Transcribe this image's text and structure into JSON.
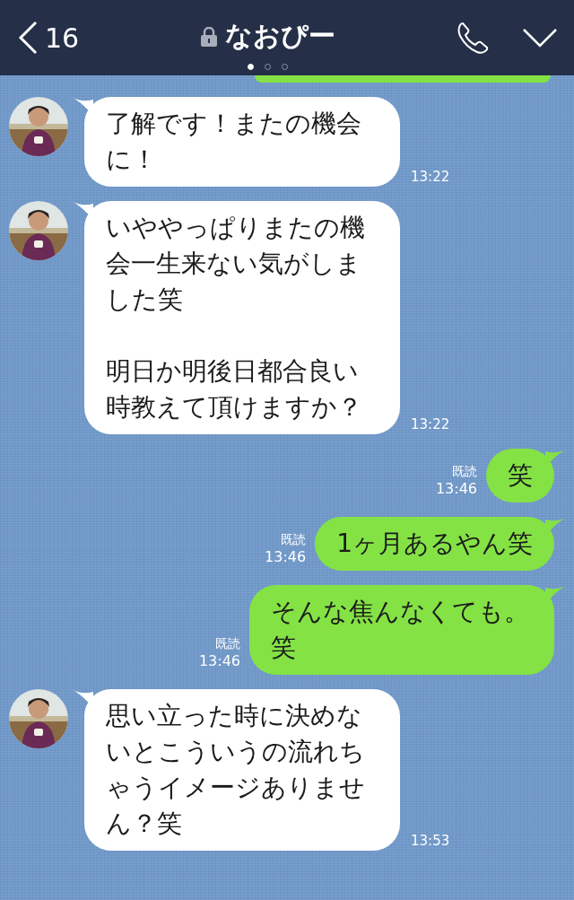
{
  "header": {
    "back_count": "16",
    "title": "なおぴー",
    "pages": [
      {
        "selected": true
      },
      {
        "selected": false
      },
      {
        "selected": false
      }
    ]
  },
  "messages": [
    {
      "kind": "partial"
    },
    {
      "kind": "incoming",
      "paragraphs": [
        "了解です！またの機会に！"
      ],
      "time": "13:22"
    },
    {
      "kind": "incoming",
      "paragraphs": [
        "いややっぱりまたの機会一生来ない気がしました笑",
        "明日か明後日都合良い時教えて頂けますか？"
      ],
      "time": "13:22"
    },
    {
      "kind": "outgoing",
      "paragraphs": [
        "笑"
      ],
      "read": "既読",
      "time": "13:46"
    },
    {
      "kind": "outgoing",
      "paragraphs": [
        "1ヶ月あるやん笑"
      ],
      "read": "既読",
      "time": "13:46"
    },
    {
      "kind": "outgoing",
      "paragraphs": [
        "そんな焦んなくても。笑"
      ],
      "read": "既読",
      "time": "13:46"
    },
    {
      "kind": "incoming",
      "paragraphs": [
        "思い立った時に決めないとこういうの流れちゃうイメージありません？笑"
      ],
      "time": "13:53"
    }
  ]
}
